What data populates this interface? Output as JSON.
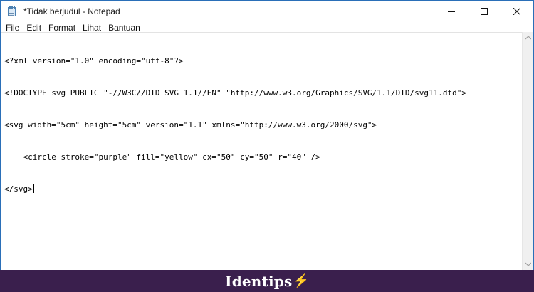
{
  "window": {
    "title": "*Tidak berjudul - Notepad"
  },
  "menu": [
    "File",
    "Edit",
    "Format",
    "Lihat",
    "Bantuan"
  ],
  "editor": {
    "lines": [
      "<?xml version=\"1.0\" encoding=\"utf-8\"?>",
      "<!DOCTYPE svg PUBLIC \"-//W3C//DTD SVG 1.1//EN\" \"http://www.w3.org/Graphics/SVG/1.1/DTD/svg11.dtd\">",
      "<svg width=\"5cm\" height=\"5cm\" version=\"1.1\" xmlns=\"http://www.w3.org/2000/svg\">",
      "    <circle stroke=\"purple\" fill=\"yellow\" cx=\"50\" cy=\"50\" r=\"40\" />",
      "</svg>"
    ]
  },
  "footer": {
    "brand": "Identips",
    "brand_mark": "⚡"
  },
  "colors": {
    "footer_bg": "#3a1f4d",
    "window_border": "#2a6fb8"
  },
  "icons": {
    "app": "notepad-icon",
    "minimize": "minimize-icon",
    "maximize": "maximize-icon",
    "close": "close-icon"
  }
}
